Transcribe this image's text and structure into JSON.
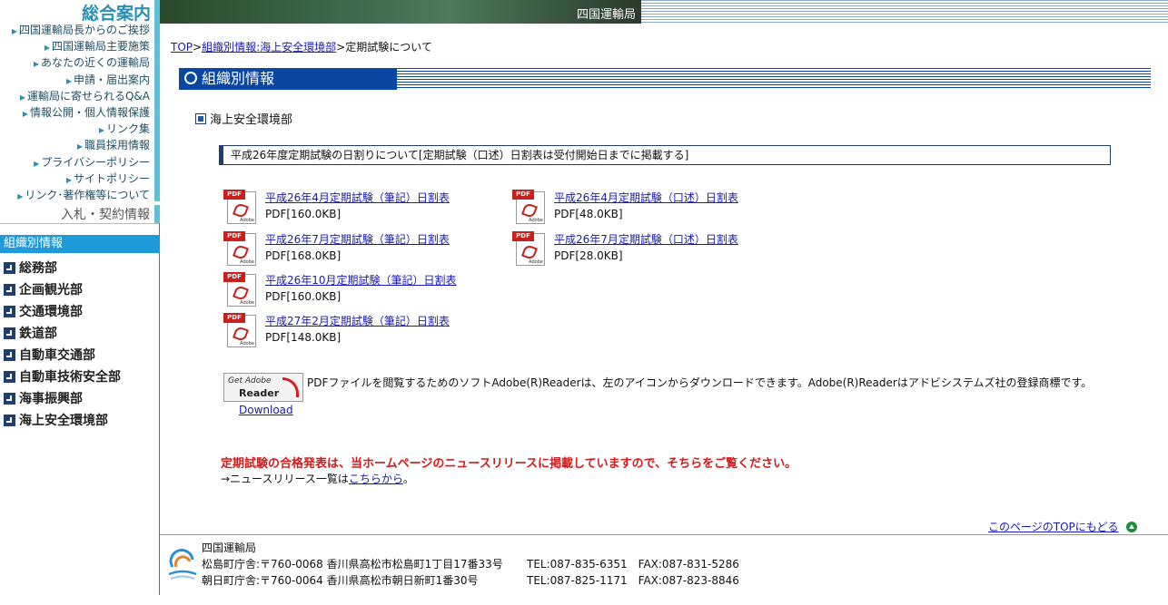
{
  "sidebar": {
    "heading": "総合案内",
    "menu": [
      "四国運輸局長からのご挨拶",
      "四国運輸局主要施策",
      "あなたの近くの運輸局",
      "申請・届出案内",
      "運輸局に寄せられるQ&A",
      "情報公開・個人情報保護",
      "リンク集",
      "職員採用情報",
      "プライバシーポリシー",
      "サイトポリシー",
      "リンク･著作権等について"
    ],
    "bid_link": "入札・契約情報",
    "org_title": "組織別情報",
    "departments": [
      "総務部",
      "企画観光部",
      "交通環境部",
      "鉄道部",
      "自動車交通部",
      "自動車技術安全部",
      "海事振興部",
      "海上安全環境部"
    ]
  },
  "banner": {
    "text": "四国運輸局"
  },
  "breadcrumb": {
    "top": "TOP",
    "sep1": ">",
    "section": "組織別情報:海上安全環境部",
    "sep2": ">",
    "current": "定期試験について"
  },
  "section_header": "組織別情報",
  "sub_heading": "海上安全環境部",
  "notice": "平成26年度定期試験の日割りについて[定期試験（口述）日割表は受付開始日までに掲載する]",
  "pdf_icon": {
    "tag": "PDF",
    "brand": "Adobe"
  },
  "pdfs": [
    {
      "title": "平成26年4月定期試験（筆記）日割表",
      "size": "PDF[160.0KB]"
    },
    {
      "title": "平成26年4月定期試験（口述）日割表",
      "size": "PDF[48.0KB]"
    },
    {
      "title": "平成26年7月定期試験（筆記）日割表",
      "size": "PDF[168.0KB]"
    },
    {
      "title": "平成26年7月定期試験（口述）日割表",
      "size": "PDF[28.0KB]"
    },
    {
      "title": "平成26年10月定期試験（筆記）日割表",
      "size": "PDF[160.0KB]"
    },
    {
      "title": "平成27年2月定期試験（筆記）日割表",
      "size": "PDF[148.0KB]"
    }
  ],
  "adobe": {
    "badge_get": "Get Adobe",
    "badge_reader": "Reader",
    "download": "Download",
    "note": "PDFファイルを閲覧するためのソフトAdobe(R)Readerは、左のアイコンからダウンロードできます。Adobe(R)Readerはアドビシステムズ社の登録商標です。"
  },
  "result_notice": "定期試験の合格発表は、当ホームページのニュースリリースに掲載していますので、そちらをご覧ください。",
  "news": {
    "prefix": "→ニュースリリース一覧は",
    "link": "こちらから",
    "suffix": "。"
  },
  "back_to_top": "このページのTOPにもどる",
  "footer": {
    "org": "四国運輸局",
    "office1": "松島町庁舎:〒760-0068 香川県高松市松島町1丁目17番33号",
    "tel1": "TEL:087-835-6351　FAX:087-831-5286",
    "office2": "朝日町庁舎:〒760-0064 香川県高松市朝日新町1番30号",
    "tel2": "TEL:087-825-1171　FAX:087-823-8846"
  }
}
